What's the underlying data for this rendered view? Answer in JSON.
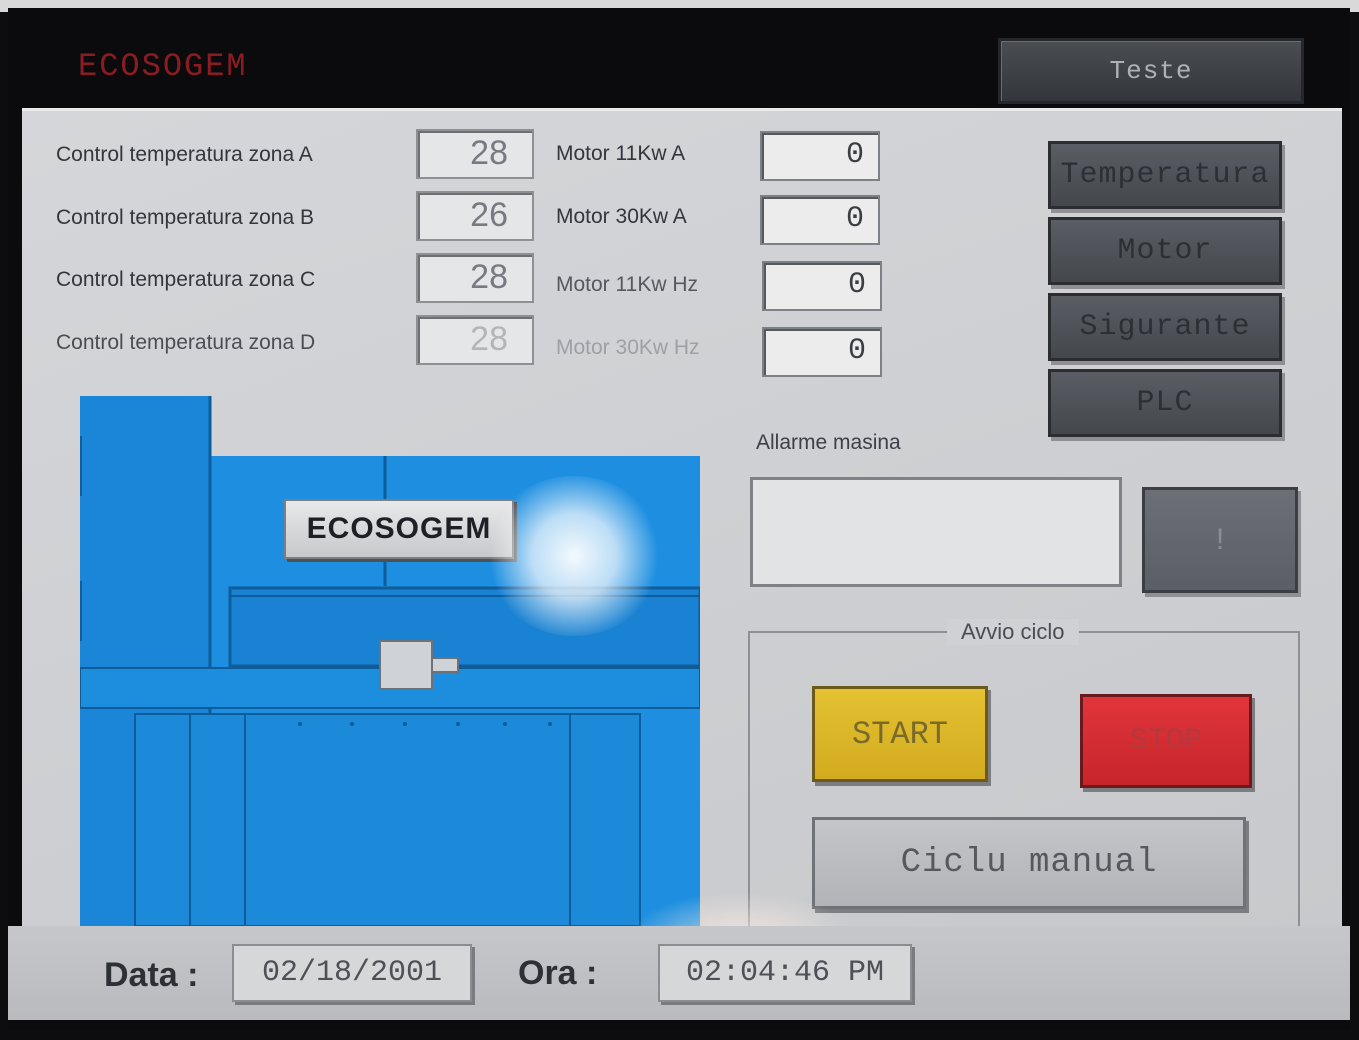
{
  "header": {
    "brand": "ECOSOGEM",
    "top_button": "Teste"
  },
  "temperature_controls": [
    {
      "label": "Control temperatura zona A",
      "value": "28"
    },
    {
      "label": "Control temperatura zona B",
      "value": "26"
    },
    {
      "label": "Control temperatura zona C",
      "value": "28"
    },
    {
      "label": "Control temperatura zona D",
      "value": "28"
    }
  ],
  "motors": [
    {
      "label": "Motor 11Kw A",
      "value": "0"
    },
    {
      "label": "Motor 30Kw A",
      "value": "0"
    },
    {
      "label": "Motor 11Kw Hz",
      "value": "0"
    },
    {
      "label": "Motor 30Kw Hz",
      "value": "0"
    }
  ],
  "nav_buttons": [
    "Temperatura",
    "Motor",
    "Sigurante",
    "PLC"
  ],
  "machine": {
    "logo": "ECOSOGEM"
  },
  "alarm": {
    "label": "Allarme masina",
    "button": "!"
  },
  "cycle": {
    "title": "Avvio ciclo",
    "start": "START",
    "stop": "STOP",
    "manual": "Ciclu manual"
  },
  "footer": {
    "date_label": "Data :",
    "date": "02/18/2001",
    "time_label": "Ora :",
    "time": "02:04:46 PM"
  },
  "colors": {
    "machine_blue": "#1e8fe0",
    "start_yellow": "#d9b425",
    "stop_red": "#d52c32",
    "brand_red": "#8a1c22"
  }
}
